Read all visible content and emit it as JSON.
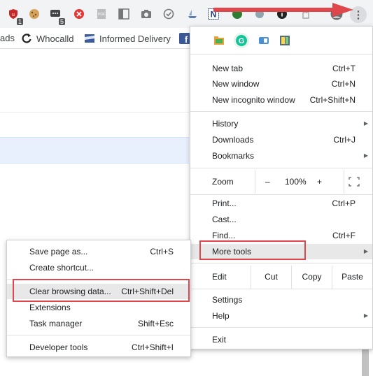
{
  "colors": {
    "annotation_red": "#e0474c",
    "highlight_blue": "#e8f0fe",
    "menu_bg": "#ffffff",
    "toolbar_bg": "#f1f3f4"
  },
  "toolbar": {
    "extensions": [
      {
        "icon": "shield-icon",
        "badge": "1"
      },
      {
        "icon": "cookie-icon",
        "badge": ""
      },
      {
        "icon": "chat-icon",
        "badge": "5"
      },
      {
        "icon": "block-icon",
        "badge": ""
      },
      {
        "icon": "pdf-icon",
        "badge": ""
      },
      {
        "icon": "panel-icon",
        "badge": ""
      },
      {
        "icon": "camera-icon",
        "badge": ""
      },
      {
        "icon": "check-circle-icon",
        "badge": ""
      },
      {
        "icon": "n-icon",
        "badge": ""
      }
    ],
    "menu_button": "⋮"
  },
  "bookmarks": [
    {
      "label": "ads",
      "icon": ""
    },
    {
      "label": "Whocalld",
      "icon": "refresh-icon"
    },
    {
      "label": "Informed Delivery",
      "icon": "usps-icon"
    }
  ],
  "menu": {
    "extensions": [
      "folder-icon",
      "grammarly-icon",
      "extension-icon",
      "notepad-icon"
    ],
    "new_tab": {
      "label": "New tab",
      "shortcut": "Ctrl+T"
    },
    "new_window": {
      "label": "New window",
      "shortcut": "Ctrl+N"
    },
    "new_incognito": {
      "label": "New incognito window",
      "shortcut": "Ctrl+Shift+N"
    },
    "history": {
      "label": "History"
    },
    "downloads": {
      "label": "Downloads",
      "shortcut": "Ctrl+J"
    },
    "bookmarks": {
      "label": "Bookmarks"
    },
    "zoom": {
      "label": "Zoom",
      "minus": "–",
      "value": "100%",
      "plus": "+"
    },
    "print": {
      "label": "Print...",
      "shortcut": "Ctrl+P"
    },
    "cast": {
      "label": "Cast..."
    },
    "find": {
      "label": "Find...",
      "shortcut": "Ctrl+F"
    },
    "more_tools": {
      "label": "More tools"
    },
    "edit": {
      "label": "Edit",
      "cut": "Cut",
      "copy": "Copy",
      "paste": "Paste"
    },
    "settings": {
      "label": "Settings"
    },
    "help": {
      "label": "Help"
    },
    "exit": {
      "label": "Exit"
    }
  },
  "submenu": {
    "save_page": {
      "label": "Save page as...",
      "shortcut": "Ctrl+S"
    },
    "create_shortcut": {
      "label": "Create shortcut..."
    },
    "clear_browsing": {
      "label": "Clear browsing data...",
      "shortcut": "Ctrl+Shift+Del"
    },
    "extensions": {
      "label": "Extensions"
    },
    "task_manager": {
      "label": "Task manager",
      "shortcut": "Shift+Esc"
    },
    "developer_tools": {
      "label": "Developer tools",
      "shortcut": "Ctrl+Shift+I"
    }
  }
}
